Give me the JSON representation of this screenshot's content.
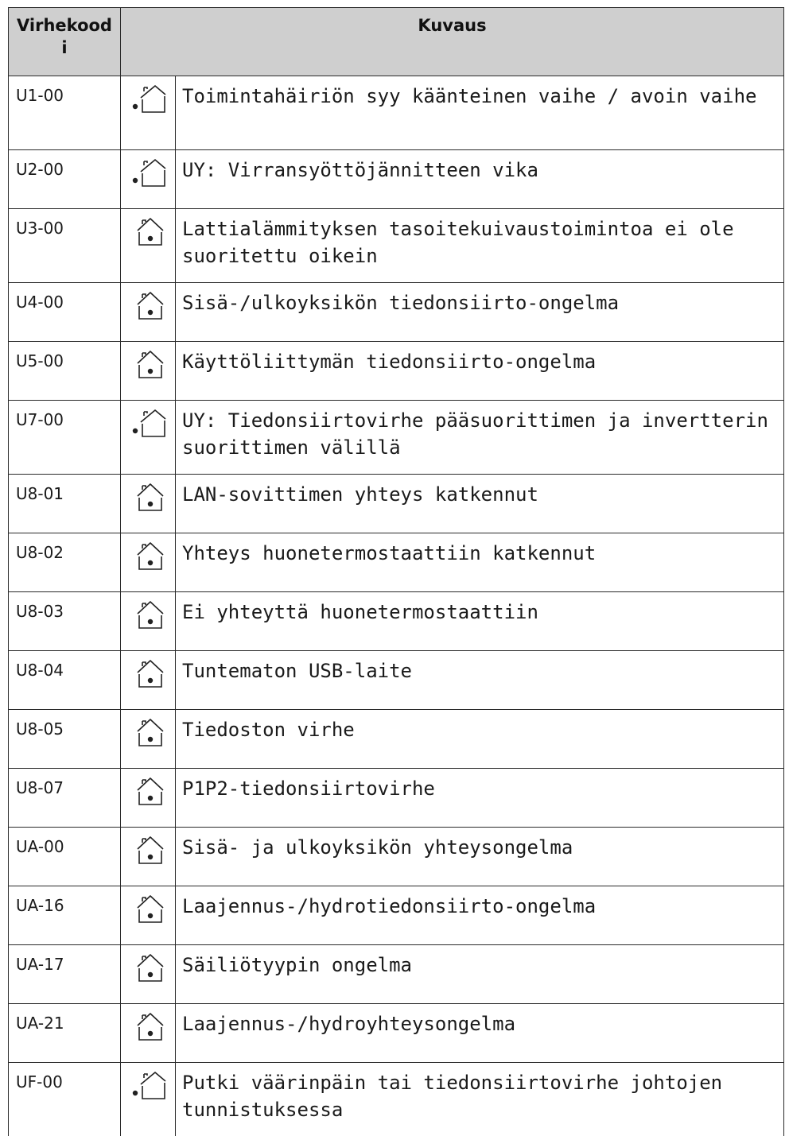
{
  "header": {
    "code_label": "Virhekood i",
    "code_line1": "Virhekood",
    "code_line2": "i",
    "desc_label": "Kuvaus"
  },
  "icons": {
    "outdoor": "outdoor-unit-house-icon",
    "indoor": "indoor-unit-house-icon"
  },
  "rows": [
    {
      "code": "U1-00",
      "icon": "outdoor",
      "desc": "Toimintahäiriön syy käänteinen vaihe / avoin vaihe"
    },
    {
      "code": "U2-00",
      "icon": "outdoor",
      "desc": "UY: Virransyöttöjännitteen vika"
    },
    {
      "code": "U3-00",
      "icon": "indoor",
      "desc": "Lattialämmityksen tasoitekuivaustoimintoa ei ole suoritettu oikein"
    },
    {
      "code": "U4-00",
      "icon": "indoor",
      "desc": "Sisä-/ulkoyksikön tiedonsiirto-ongelma"
    },
    {
      "code": "U5-00",
      "icon": "indoor",
      "desc": "Käyttöliittymän tiedonsiirto-ongelma"
    },
    {
      "code": "U7-00",
      "icon": "outdoor",
      "desc": "UY: Tiedonsiirtovirhe pääsuorittimen ja invertterin suorittimen välillä"
    },
    {
      "code": "U8-01",
      "icon": "indoor",
      "desc": "LAN-sovittimen yhteys katkennut"
    },
    {
      "code": "U8-02",
      "icon": "indoor",
      "desc": "Yhteys huonetermostaattiin katkennut"
    },
    {
      "code": "U8-03",
      "icon": "indoor",
      "desc": "Ei yhteyttä huonetermostaattiin"
    },
    {
      "code": "U8-04",
      "icon": "indoor",
      "desc": "Tuntematon USB-laite"
    },
    {
      "code": "U8-05",
      "icon": "indoor",
      "desc": "Tiedoston virhe"
    },
    {
      "code": "U8-07",
      "icon": "indoor",
      "desc": "P1P2-tiedonsiirtovirhe"
    },
    {
      "code": "UA-00",
      "icon": "indoor",
      "desc": "Sisä- ja ulkoyksikön yhteysongelma"
    },
    {
      "code": "UA-16",
      "icon": "indoor",
      "desc": "Laajennus-/hydrotiedonsiirto-ongelma"
    },
    {
      "code": "UA-17",
      "icon": "indoor",
      "desc": "Säiliötyypin ongelma"
    },
    {
      "code": "UA-21",
      "icon": "indoor",
      "desc": "Laajennus-/hydroyhteysongelma"
    },
    {
      "code": "UF-00",
      "icon": "outdoor",
      "desc": "Putki väärinpäin tai tiedonsiirtovirhe johtojen tunnistuksessa"
    }
  ]
}
